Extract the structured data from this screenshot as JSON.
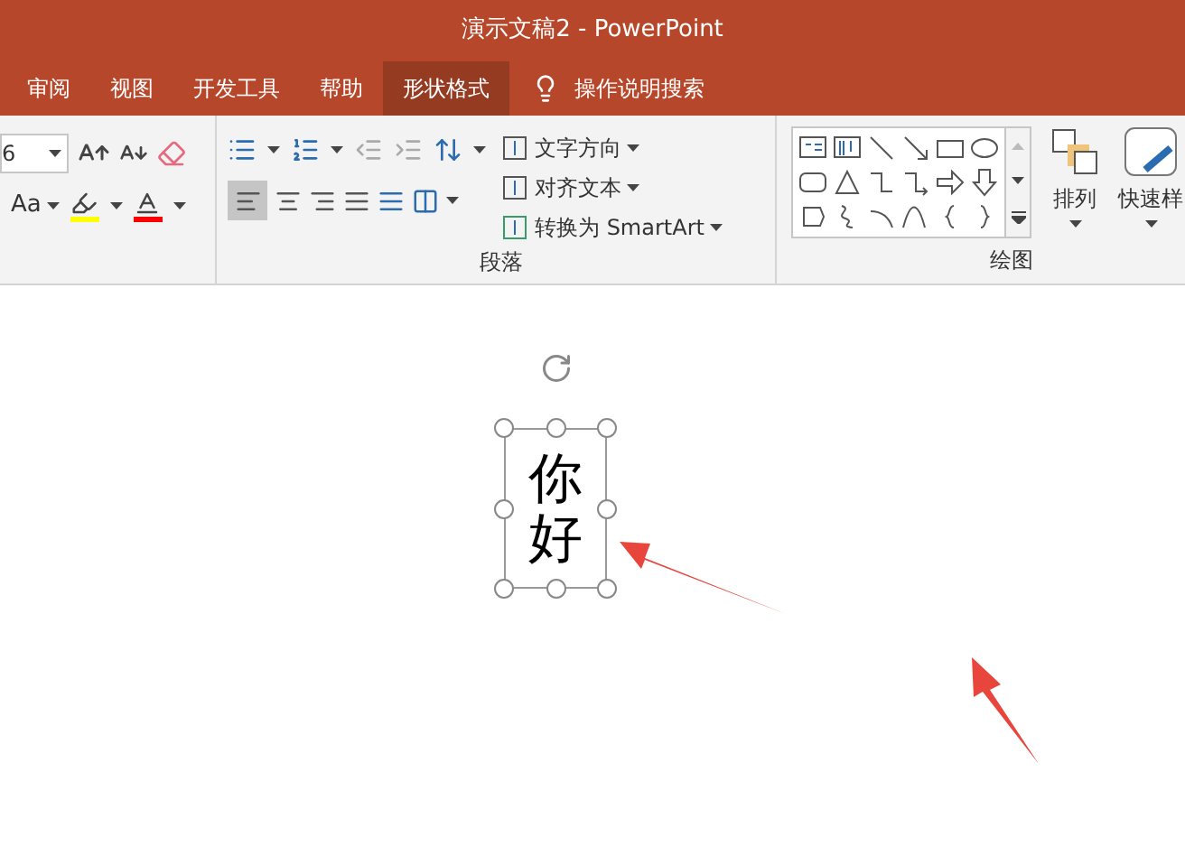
{
  "window": {
    "title": "演示文稿2  -  PowerPoint"
  },
  "tabs": [
    {
      "label": "审阅",
      "selected": false
    },
    {
      "label": "视图",
      "selected": false
    },
    {
      "label": "开发工具",
      "selected": false
    },
    {
      "label": "帮助",
      "selected": false
    },
    {
      "label": "形状格式",
      "selected": true
    }
  ],
  "tell_me": {
    "placeholder": "操作说明搜索"
  },
  "font_group": {
    "font_size": "6",
    "change_case": "Aa"
  },
  "paragraph_group": {
    "label": "段落",
    "commands": [
      "文字方向",
      "对齐文本",
      "转换为 SmartArt"
    ],
    "align_left_selected": true
  },
  "drawing_group": {
    "label": "绘图",
    "arrange": "排列",
    "quick_styles": "快速样"
  },
  "slide": {
    "text_box": {
      "text": "你好",
      "selected": true
    }
  }
}
